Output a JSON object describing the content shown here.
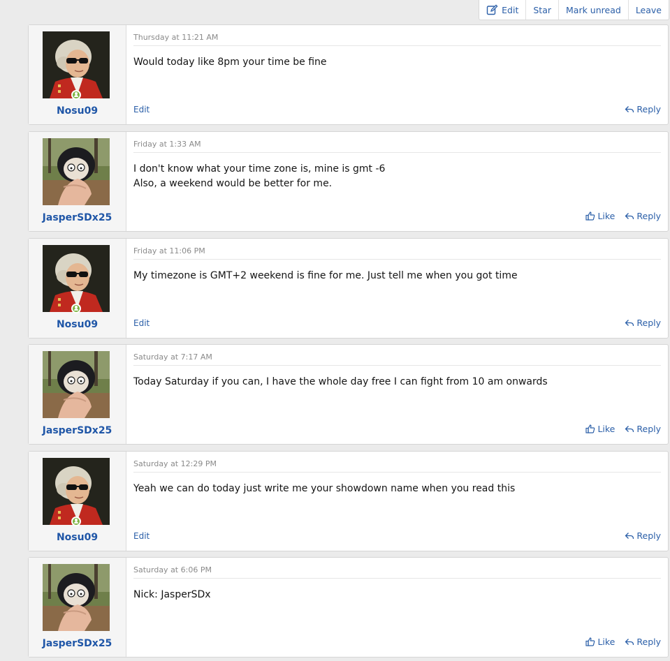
{
  "toolbar": {
    "edit": "Edit",
    "star": "Star",
    "mark_unread": "Mark unread",
    "leave": "Leave"
  },
  "colors": {
    "link": "#2b5fa8",
    "username": "#1f56a7",
    "online": "#7cb342",
    "background": "#ebebeb"
  },
  "messages": [
    {
      "user": "Nosu09",
      "avatar": "mozart-portrait-with-sunglasses",
      "online": true,
      "date": "Thursday at 11:21 AM",
      "lines": [
        "Would today like 8pm your time be fine"
      ],
      "edit": "Edit",
      "reply": "Reply"
    },
    {
      "user": "JasperSDx25",
      "avatar": "plush-figure-outdoors",
      "online": false,
      "date": "Friday at 1:33 AM",
      "lines": [
        "I don't know what your time zone is, mine is gmt -6",
        "Also, a weekend would be better for me."
      ],
      "like": "Like",
      "reply": "Reply"
    },
    {
      "user": "Nosu09",
      "avatar": "mozart-portrait-with-sunglasses",
      "online": true,
      "date": "Friday at 11:06 PM",
      "lines": [
        "My timezone is GMT+2 weekend is fine for me. Just tell me when you got time"
      ],
      "edit": "Edit",
      "reply": "Reply"
    },
    {
      "user": "JasperSDx25",
      "avatar": "plush-figure-outdoors",
      "online": false,
      "date": "Saturday at 7:17 AM",
      "lines": [
        "Today Saturday if you can, I have the whole day free I can fight from 10 am onwards"
      ],
      "like": "Like",
      "reply": "Reply"
    },
    {
      "user": "Nosu09",
      "avatar": "mozart-portrait-with-sunglasses",
      "online": true,
      "date": "Saturday at 12:29 PM",
      "lines": [
        "Yeah we can do today just write me your showdown name when you read this"
      ],
      "edit": "Edit",
      "reply": "Reply"
    },
    {
      "user": "JasperSDx25",
      "avatar": "plush-figure-outdoors",
      "online": false,
      "date": "Saturday at 6:06 PM",
      "lines": [
        "Nick: JasperSDx"
      ],
      "like": "Like",
      "reply": "Reply"
    }
  ]
}
